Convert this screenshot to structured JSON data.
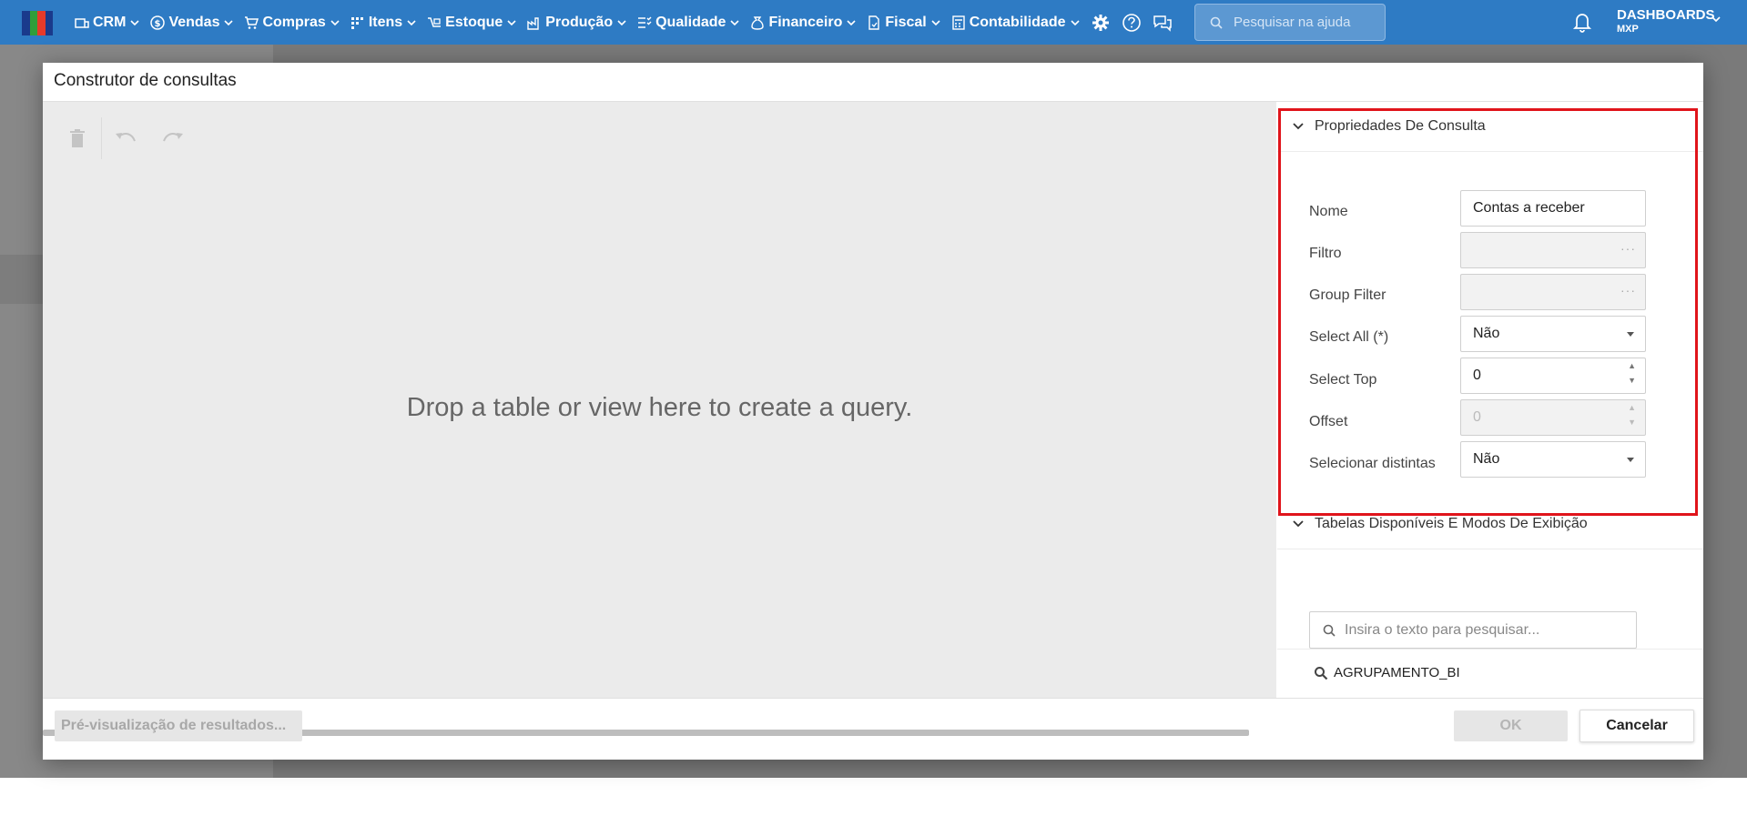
{
  "nav": {
    "items": [
      {
        "label": "CRM",
        "icon": "crm-icon"
      },
      {
        "label": "Vendas",
        "icon": "dollar-icon"
      },
      {
        "label": "Compras",
        "icon": "cart-icon"
      },
      {
        "label": "Itens",
        "icon": "items-icon"
      },
      {
        "label": "Estoque",
        "icon": "stock-icon"
      },
      {
        "label": "Produção",
        "icon": "factory-icon"
      },
      {
        "label": "Qualidade",
        "icon": "checklist-icon"
      },
      {
        "label": "Financeiro",
        "icon": "moneybag-icon"
      },
      {
        "label": "Fiscal",
        "icon": "document-icon"
      },
      {
        "label": "Contabilidade",
        "icon": "calculator-icon"
      }
    ],
    "help_search_placeholder": "Pesquisar na ajuda",
    "dashboards_label": "DASHBOARDS",
    "dashboards_sub": "MXP"
  },
  "dialog": {
    "title": "Construtor de consultas",
    "drop_hint": "Drop a table or view here to create a query.",
    "preview_button": "Pré-visualização de resultados...",
    "ok_button": "OK",
    "cancel_button": "Cancelar"
  },
  "properties": {
    "section_title": "Propriedades De Consulta",
    "fields": {
      "nome_label": "Nome",
      "nome_value": "Contas a receber",
      "filtro_label": "Filtro",
      "group_filter_label": "Group Filter",
      "select_all_label": "Select All (*)",
      "select_all_value": "Não",
      "select_top_label": "Select Top",
      "select_top_value": "0",
      "offset_label": "Offset",
      "offset_value": "0",
      "distintas_label": "Selecionar distintas",
      "distintas_value": "Não"
    }
  },
  "tables": {
    "section_title": "Tabelas Disponíveis E Modos De Exibição",
    "search_placeholder": "Insira o texto para pesquisar...",
    "items": [
      "AGRUPAMENTO_BI"
    ]
  },
  "colors": {
    "topbar": "#2e7bc4",
    "highlight": "#e0141b"
  }
}
